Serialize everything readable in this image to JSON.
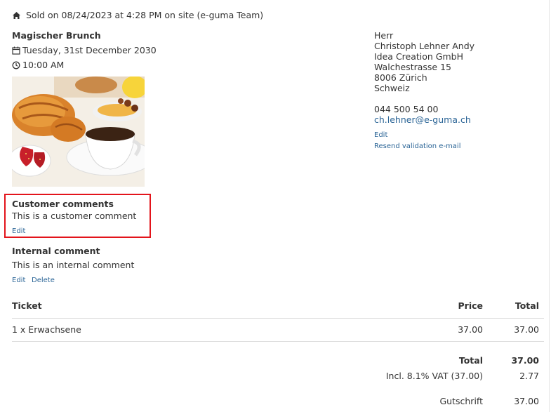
{
  "sale": {
    "icon": "home-icon",
    "text": "Sold on 08/24/2023 at 4:28 PM on site (e-guma Team)"
  },
  "event": {
    "title": "Magischer Brunch",
    "date": "Tuesday, 31st December 2030",
    "time": "10:00 AM",
    "image_icon": "breakfast-photo"
  },
  "customer": {
    "salutation": "Herr",
    "name": "Christoph Lehner Andy",
    "company": "Idea Creation GmbH",
    "street": "Walchestrasse 15",
    "city": "8006 Zürich",
    "country": "Schweiz",
    "phone": "044 500 54 00",
    "email": "ch.lehner@e-guma.ch",
    "edit_label": "Edit",
    "resend_label": "Resend validation e-mail"
  },
  "customer_comments": {
    "heading": "Customer comments",
    "text": "This is a customer comment",
    "edit_label": "Edit"
  },
  "internal_comment": {
    "heading": "Internal comment",
    "text": "This is an internal comment",
    "edit_label": "Edit",
    "delete_label": "Delete"
  },
  "table": {
    "headers": {
      "ticket": "Ticket",
      "price": "Price",
      "total": "Total"
    },
    "rows": [
      {
        "ticket": "1 x Erwachsene",
        "price": "37.00",
        "total": "37.00"
      }
    ]
  },
  "summary": {
    "total_label": "Total",
    "total_value": "37.00",
    "vat_label": "Incl. 8.1% VAT (37.00)",
    "vat_value": "2.77",
    "credit_label": "Gutschrift",
    "credit_value": "37.00"
  },
  "colors": {
    "link": "#2a6496",
    "highlight_border": "#e3141b",
    "text": "#333333"
  }
}
